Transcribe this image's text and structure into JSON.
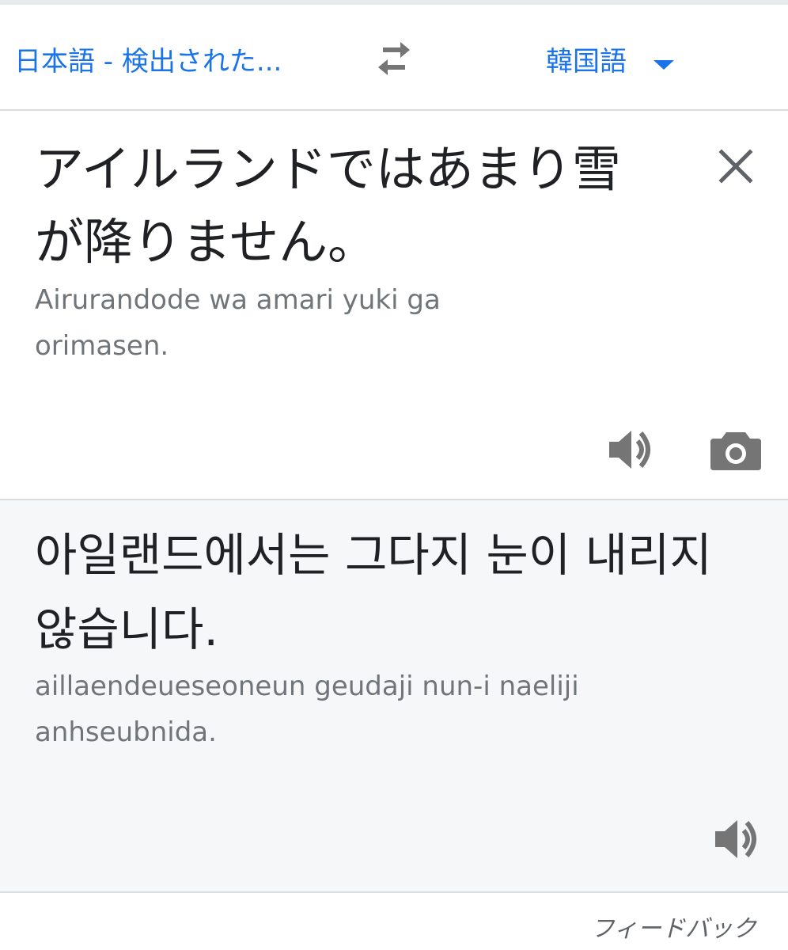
{
  "language_bar": {
    "source_language": "日本語 - 検出された...",
    "target_language": "韓国語",
    "swap_icon": "swap-arrows-icon",
    "dropdown_icon": "caret-down-icon"
  },
  "source": {
    "text": "アイルランドではあまり雪が降りません。",
    "romanization": "Airurandode wa amari yuki ga orimasen.",
    "icons": [
      "close-icon",
      "speaker-icon",
      "camera-icon"
    ]
  },
  "translation": {
    "text": "아일랜드에서는 그다지 눈이 내리지 않습니다.",
    "romanization": "aillaendeueseoneun geudaji nun-i naeliji anhseubnida.",
    "icons": [
      "speaker-icon"
    ]
  },
  "footer": {
    "feedback_label": "フィードバック"
  },
  "colors": {
    "accent": "#1a73e8",
    "icon_gray": "#757575",
    "primary_text": "#202124",
    "secondary_text": "#70757a",
    "result_background": "#f6f7f9"
  }
}
